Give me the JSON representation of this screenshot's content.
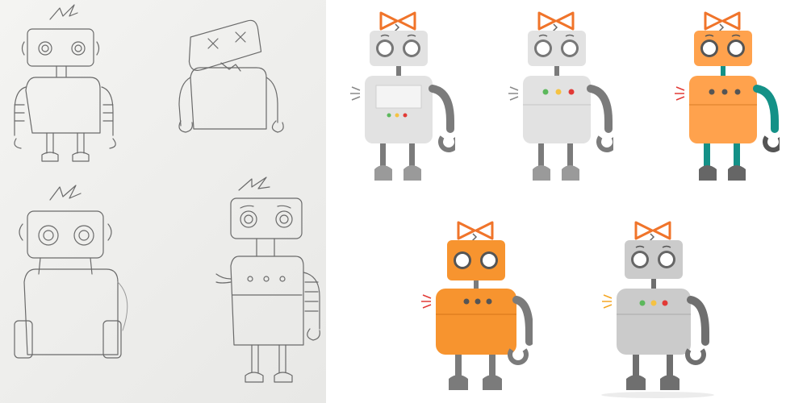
{
  "sketches": [
    {
      "name": "sketch-robot-happy"
    },
    {
      "name": "sketch-robot-broken"
    },
    {
      "name": "sketch-robot-big"
    },
    {
      "name": "sketch-robot-sad"
    }
  ],
  "robots": [
    {
      "name": "robot-gray-screen",
      "body": "#e2e2e2",
      "head": "#e2e2e2",
      "limb": "#7b7b7b",
      "bow": "#f0742a",
      "screen": "#f4f4f4",
      "panel_lights": [
        "#5cb85c",
        "#f5c242",
        "#e23a36"
      ]
    },
    {
      "name": "robot-gray-lights",
      "body": "#e2e2e2",
      "head": "#e2e2e2",
      "limb": "#7b7b7b",
      "bow": "#f0742a",
      "panel_lights": [
        "#5cb85c",
        "#f5c242",
        "#e23a36"
      ]
    },
    {
      "name": "robot-orange-teal",
      "body": "#ffa24d",
      "head": "#ffa24d",
      "limb": "#149187",
      "bow": "#f0742a",
      "panel_lights": [
        "#555555",
        "#555555",
        "#555555"
      ]
    },
    {
      "name": "robot-orange",
      "body": "#f7942f",
      "head": "#f7942f",
      "limb": "#7b7b7b",
      "bow": "#f0742a",
      "panel_lights": [
        "#555555",
        "#555555",
        "#555555"
      ]
    },
    {
      "name": "robot-gray-final",
      "body": "#cbcbcb",
      "head": "#cbcbcb",
      "limb": "#6f6f6f",
      "bow": "#f0742a",
      "panel_lights": [
        "#5cb85c",
        "#f5c242",
        "#e23a36"
      ]
    }
  ]
}
